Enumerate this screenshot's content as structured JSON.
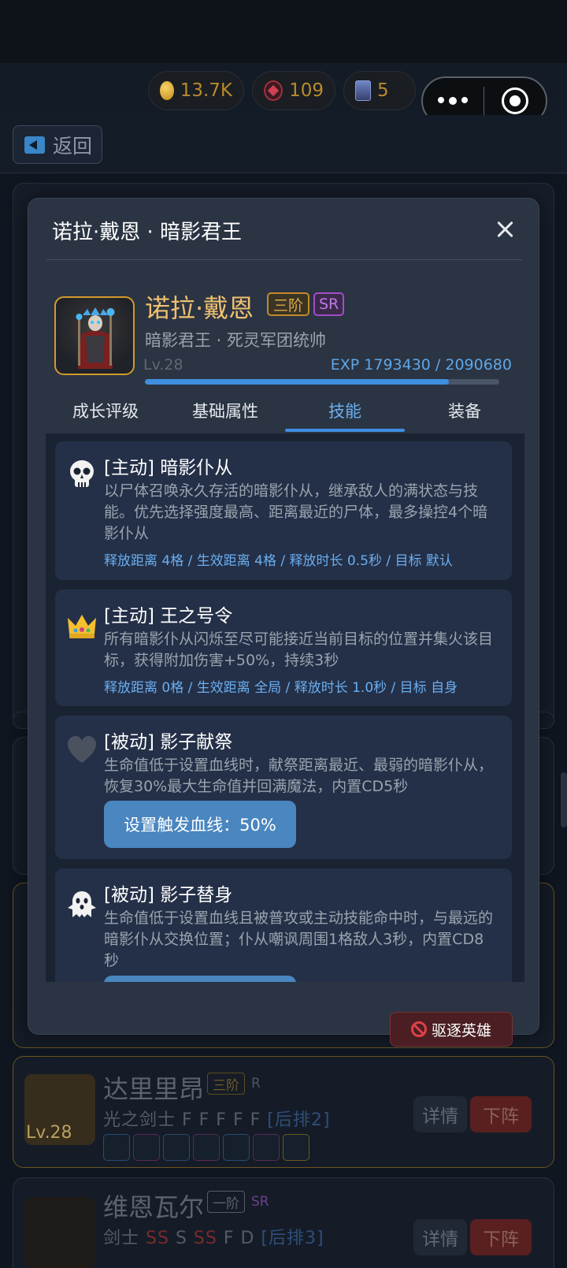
{
  "resources": {
    "gold": "13.7K",
    "gems": "109",
    "cards": "5"
  },
  "nav": {
    "back_label": "返回"
  },
  "bg_heroes": [
    {
      "level": "Lv.28",
      "name": "达里里昂",
      "rank": "三阶",
      "rarity": "R",
      "class_line": "光之剑士",
      "grades": "F F F F F",
      "position": "[后排2]",
      "detail_label": "详情",
      "remove_label": "下阵"
    },
    {
      "name": "维恩瓦尔",
      "rank": "一阶",
      "rarity": "SR",
      "class_line": "剑士",
      "grades": [
        "SS",
        "S",
        "SS",
        "F",
        "D"
      ],
      "position": "[后排3]",
      "detail_label": "详情",
      "remove_label": "下阵"
    }
  ],
  "modal": {
    "title": "诺拉·戴恩 · 暗影君王",
    "hero": {
      "name": "诺拉·戴恩",
      "rank": "三阶",
      "rarity": "SR",
      "subtitle": "暗影君王 · 死灵军团统帅",
      "level": "Lv.28",
      "exp_text": "EXP 1793430 / 2090680",
      "exp_progress": 0.8577
    },
    "tabs": [
      {
        "label": "成长评级"
      },
      {
        "label": "基础属性"
      },
      {
        "label": "技能",
        "active": true
      },
      {
        "label": "装备"
      }
    ],
    "skills": [
      {
        "icon": "skull-icon",
        "title": "[主动] 暗影仆从",
        "desc": "以尸体召唤永久存活的暗影仆从，继承敌人的满状态与技能。优先选择强度最高、距离最近的尸体，最多操控4个暗影仆从",
        "meta": "释放距离 4格 / 生效距离 4格 / 释放时长 0.5秒 / 目标 默认"
      },
      {
        "icon": "crown-icon",
        "title": "[主动] 王之号令",
        "desc": "所有暗影仆从闪烁至尽可能接近当前目标的位置并集火该目标，获得附加伤害+50%，持续3秒",
        "meta": "释放距离 0格 / 生效距离 全局 / 释放时长 1.0秒 / 目标 自身"
      },
      {
        "icon": "heart-icon",
        "title": "[被动] 影子献祭",
        "desc": "生命值低于设置血线时，献祭距离最近、最弱的暗影仆从，恢复30%最大生命值并回满魔法，内置CD5秒",
        "button": "设置触发血线：50%"
      },
      {
        "icon": "ghost-icon",
        "title": "[被动] 影子替身",
        "desc": "生命值低于设置血线且被普攻或主动技能命中时，与最远的暗影仆从交换位置；仆从嘲讽周围1格敌人3秒，内置CD8秒"
      }
    ],
    "evict_label": "驱逐英雄"
  },
  "colors": {
    "accent": "#3f8ee0",
    "gold_text": "#f0c070",
    "sr_purple": "#a04ec8",
    "danger": "#e04048"
  }
}
